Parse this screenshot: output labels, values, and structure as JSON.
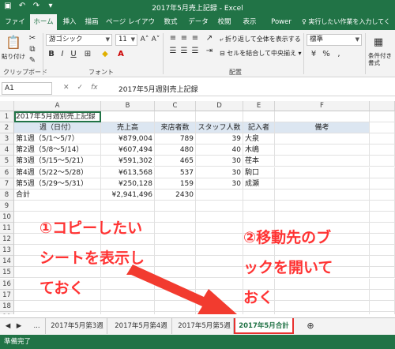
{
  "window": {
    "title": "2017年5月売上記録 - Excel"
  },
  "tabs": [
    "ファイル",
    "ホーム",
    "挿入",
    "描画",
    "ページ レイアウト",
    "数式",
    "データ",
    "校閲",
    "表示",
    "Power Pivot"
  ],
  "active_tab": "ホーム",
  "tell_me": "実行したい作業を入力してください",
  "ribbon": {
    "paste_label": "貼り付け",
    "clipboard_label": "クリップボード",
    "font_name": "游ゴシック",
    "font_size": "11",
    "font_label": "フォント",
    "wrap_label": "折り返して全体を表示する",
    "merge_label": "セルを結合して中央揃え",
    "align_label": "配置",
    "number_format": "標準",
    "conditional_label": "条件付き書式"
  },
  "formula_bar": {
    "name_box": "A1",
    "formula": "2017年5月週別売上記録"
  },
  "columns": [
    "A",
    "B",
    "C",
    "D",
    "E",
    "F"
  ],
  "rows": [
    "1",
    "2",
    "3",
    "4",
    "5",
    "6",
    "7",
    "8",
    "9",
    "10",
    "11",
    "12",
    "13",
    "14",
    "15",
    "16",
    "17",
    "18",
    "19"
  ],
  "sheet": {
    "title": "2017年5月週別売上記録",
    "header": [
      "週（日付）",
      "売上高",
      "来店者数",
      "スタッフ人数",
      "記入者",
      "備考"
    ],
    "data": [
      [
        "第1週（5/1～5/7）",
        "¥879,004",
        "789",
        "39",
        "大泉",
        ""
      ],
      [
        "第2週（5/8～5/14）",
        "¥607,494",
        "480",
        "40",
        "木嶋",
        ""
      ],
      [
        "第3週（5/15～5/21）",
        "¥591,302",
        "465",
        "30",
        "荏本",
        ""
      ],
      [
        "第4週（5/22～5/28）",
        "¥613,568",
        "537",
        "30",
        "駒口",
        ""
      ],
      [
        "第5週（5/29～5/31）",
        "¥250,128",
        "159",
        "30",
        "成瀬",
        ""
      ]
    ],
    "total": [
      "合計",
      "¥2,941,496",
      "2430",
      "",
      "",
      ""
    ]
  },
  "annotations": {
    "left": [
      "①コピーしたい",
      "シートを表示し",
      "ておく"
    ],
    "right": [
      "②移動先のブ",
      "ックを開いて",
      "おく"
    ]
  },
  "sheet_tabs": [
    "...",
    "2017年5月第3週",
    "2017年5月第4週",
    "2017年5月第5週",
    "2017年5月合計"
  ],
  "active_sheet": "2017年5月合計",
  "status": "準備完了",
  "colors": {
    "excel_green": "#217346",
    "annotation_red": "#ff3333",
    "header_fill": "#dce6f1"
  }
}
